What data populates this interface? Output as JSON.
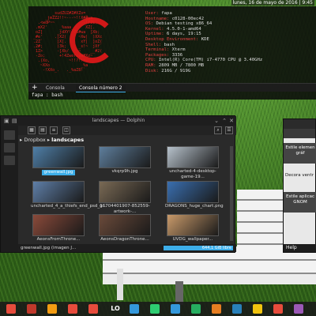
{
  "clock": "lunes, 16 de mayo de 2016 | 9:45",
  "terminal": {
    "ascii_lines": [
      "        _sudZUZ#Z#XZo=_",
      "     _jmZZ2!!~---~!!X##wa",
      "  .<wdP~~            -!YZL,",
      " .mX2'     _%aaa__    XZ[.",
      " oZ[      _jdXY!~?S#wa  ]Xb;",
      "_#e'     .]X2(     ~Xw|  )XXc",
      ".2Z`      ]X[.      xY|  ]oZ(",
      ".2#;      )3k;     _s!~  jXf`",
      " 1Z>      -]Xb/    ~    __#2(",
      " -Zo;      +!4ZwerssW#Xz~",
      "  .)Xo,        ~!!?!!~-",
      "   ~XXo             _%a",
      "    -!XXo_.   ._%aZ8!`"
    ],
    "info": [
      {
        "k": "User:",
        "v": "fapa"
      },
      {
        "k": "Hostname:",
        "v": "c0128-00ec42"
      },
      {
        "k": "OS:",
        "v": "Debian testing x86_64"
      },
      {
        "k": "Kernel:",
        "v": "4.5.0-1-amd64"
      },
      {
        "k": "Uptime:",
        "v": "6 days, 19:15"
      },
      {
        "k": "Desktop Environment:",
        "v": "KDE"
      },
      {
        "k": "Shell:",
        "v": "bash"
      },
      {
        "k": "Terminal:",
        "v": "Xterm"
      },
      {
        "k": "Packages:",
        "v": "3336"
      },
      {
        "k": "CPU:",
        "v": "Intel(R) Core(TM) i7-4770 CPU @ 3.40GHz"
      },
      {
        "k": "RAM:",
        "v": "2809 MB / 7800 MB"
      },
      {
        "k": "Disk:",
        "v": "216G / 919G"
      }
    ],
    "tabs": [
      "Consola",
      "Consola número 2"
    ],
    "prompt": "fapa : bash"
  },
  "dolphin": {
    "title": "landscapes — Dolphin",
    "breadcrumb_root": "Dropbox",
    "breadcrumb_current": "landscapes",
    "files": [
      {
        "name": "greenwall.jpg",
        "color": "#4f7fa8",
        "selected": true
      },
      {
        "name": "vkqrp9h.jpg",
        "color": "#5e7e9c",
        "selected": false
      },
      {
        "name": "uncharted-4-desktop-game-19...",
        "color": "#b7c2cc",
        "selected": false
      },
      {
        "name": "uncharted_4_a_thiefs_end_psd_g...",
        "color": "#5f7fa8",
        "selected": false
      },
      {
        "name": "16704401907-852559-artwork-...",
        "color": "#7a6a55",
        "selected": false
      },
      {
        "name": "DRAGONS_huge_chart.png",
        "color": "#3a6fb0",
        "selected": false
      },
      {
        "name": "AeonsFromThrone...",
        "color": "#8a4a3a",
        "selected": false
      },
      {
        "name": "AeonsDragonThrone...",
        "color": "#6a4a3a",
        "selected": false
      },
      {
        "name": "UVDG_wallpaper...",
        "color": "#c99a6a",
        "selected": false
      }
    ],
    "status": "greenwall.jpg (imagen J...",
    "disk_free": "644,1 GiB libre"
  },
  "right_window": {
    "text1": "Estile elemen gráf",
    "text2": "Decora ventr",
    "text3": "Estile aplicac GNOM",
    "help": "Help"
  },
  "taskbar": {
    "icons": [
      {
        "name": "files-icon",
        "color": "#e74c3c"
      },
      {
        "name": "apps-icon",
        "color": "#c0392b"
      },
      {
        "name": "download-icon",
        "color": "#f39c12"
      },
      {
        "name": "list-icon",
        "color": "#e74c3c"
      },
      {
        "name": "pdf-icon",
        "color": "#e74c3c"
      },
      {
        "name": "libreoffice-label",
        "color": "#ffffff"
      },
      {
        "name": "folder-icon",
        "color": "#3498db"
      },
      {
        "name": "image-icon",
        "color": "#2ecc71"
      },
      {
        "name": "activity-icon",
        "color": "#3498db"
      },
      {
        "name": "tools-icon",
        "color": "#27ae60"
      },
      {
        "name": "arrow-icon",
        "color": "#e67e22"
      },
      {
        "name": "music-icon",
        "color": "#2980b9"
      },
      {
        "name": "notes-icon",
        "color": "#f1c40f"
      },
      {
        "name": "chrome-icon",
        "color": "#e74c3c"
      },
      {
        "name": "other-icon",
        "color": "#9b59b6"
      }
    ],
    "lo_label": "LO"
  }
}
